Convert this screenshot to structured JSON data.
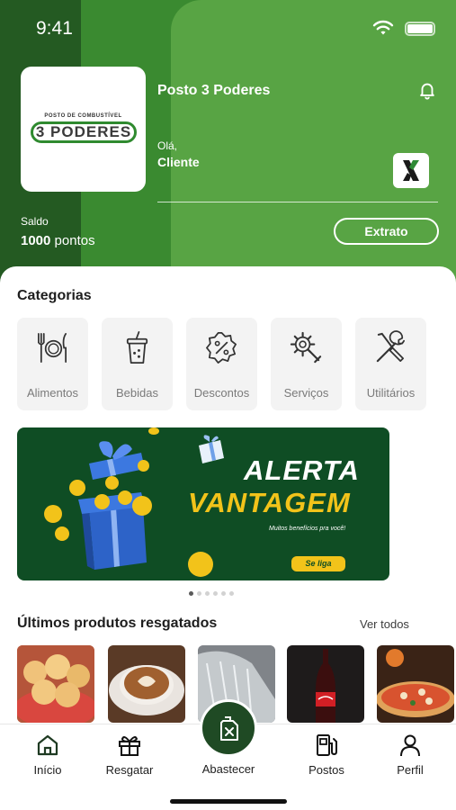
{
  "status_bar": {
    "time": "9:41"
  },
  "header": {
    "logo": {
      "top_text": "POSTO DE COMBUSTÍVEL",
      "name": "3 PODERES"
    },
    "store_name": "Posto 3 Poderes",
    "greeting": "Olá,",
    "client_name": "Cliente",
    "saldo_label": "Saldo",
    "saldo_value": "1000",
    "saldo_unit": "pontos",
    "extrato_label": "Extrato"
  },
  "categories": {
    "title": "Categorias",
    "items": [
      {
        "label": "Alimentos",
        "icon": "utensils-icon"
      },
      {
        "label": "Bebidas",
        "icon": "drink-cup-icon"
      },
      {
        "label": "Descontos",
        "icon": "discount-badge-icon"
      },
      {
        "label": "Serviços",
        "icon": "gear-wrench-icon"
      },
      {
        "label": "Utilitários",
        "icon": "tools-icon"
      }
    ]
  },
  "banner": {
    "title_line1": "ALERTA",
    "title_line2": "VANTAGEM",
    "subtitle": "Muitos benefícios pra você!",
    "cta": "Se liga",
    "colors": {
      "background": "#0f4d24",
      "accent": "#f2c31a"
    },
    "slides": 6,
    "active_slide": 1
  },
  "recent": {
    "title": "Últimos produtos resgatados",
    "see_all": "Ver todos",
    "products": [
      {
        "name": "pao-de-queijo-image"
      },
      {
        "name": "cappuccino-image"
      },
      {
        "name": "car-wash-image"
      },
      {
        "name": "coca-cola-image"
      },
      {
        "name": "pizza-image"
      }
    ]
  },
  "nav": {
    "items": [
      {
        "label": "Início",
        "icon": "home-icon"
      },
      {
        "label": "Resgatar",
        "icon": "gift-icon"
      },
      {
        "label": "Abastecer",
        "icon": "fuel-can-icon"
      },
      {
        "label": "Postos",
        "icon": "gas-station-icon"
      },
      {
        "label": "Perfil",
        "icon": "user-icon"
      }
    ]
  },
  "colors": {
    "brand_green": "#4f9a3c",
    "dark_green": "#1f4a24"
  }
}
